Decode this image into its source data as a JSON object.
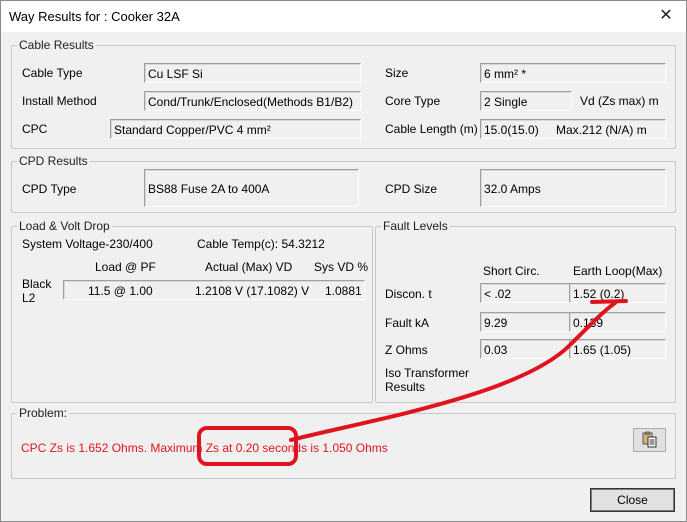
{
  "window": {
    "title": "Way Results for : Cooker 32A",
    "close_glyph": "✕"
  },
  "cable": {
    "group": "Cable Results",
    "cable_type_label": "Cable Type",
    "cable_type": "Cu LSF  Si",
    "install_label": "Install Method",
    "install": "Cond/Trunk/Enclosed(Methods B1/B2)",
    "cpc_label": "CPC",
    "cpc": "Standard Copper/PVC 4 mm²",
    "size_label": "Size",
    "size": "6 mm² *",
    "core_label": "Core Type",
    "core": "2 Single",
    "vd_label": "Vd   (Zs max) m",
    "length_label": "Cable Length (m)",
    "length": "15.0(15.0)",
    "max": "Max.212 (N/A) m"
  },
  "cpd": {
    "group": "CPD Results",
    "type_label": "CPD Type",
    "type": "BS88 Fuse 2A to 400A",
    "size_label": "CPD Size",
    "size": "32.0 Amps"
  },
  "load": {
    "group": "Load & Volt Drop",
    "system_voltage": "System Voltage-230/400",
    "cable_temp": "Cable Temp(c): 54.3212",
    "hdr_load": "Load @ PF",
    "hdr_vd": "Actual (Max) VD",
    "hdr_sys": "Sys VD %",
    "phase_1": "Black",
    "phase_2": "L2",
    "load": "11.5 @ 1.00",
    "vd": "1.2108  V   (17.1082)  V",
    "sys": "1.0881"
  },
  "fault": {
    "group": "Fault Levels",
    "hdr_short": "Short Circ.",
    "hdr_earth": "Earth Loop(Max)",
    "discon_label": "Discon. t",
    "discon_short": "< .02",
    "discon_earth_val": "1.52",
    "discon_earth_max": "(0.2)",
    "ka_label": "Fault kA",
    "ka_short": "9.29",
    "ka_earth": "0.139",
    "ohms_label": "Z Ohms",
    "ohms_short": "0.03",
    "ohms_earth": "1.65 (1.05)",
    "iso_1": "Iso Transformer",
    "iso_2": "Results"
  },
  "problem": {
    "group": "Problem:",
    "message": "CPC Zs is 1.652 Ohms. Maximum Zs at 0.20 seconds is 1.050 Ohms",
    "color": "#e0141e"
  },
  "buttons": {
    "close": "Close",
    "copy_icon": "clipboard-copy"
  },
  "annotation_color": "#e0141e"
}
